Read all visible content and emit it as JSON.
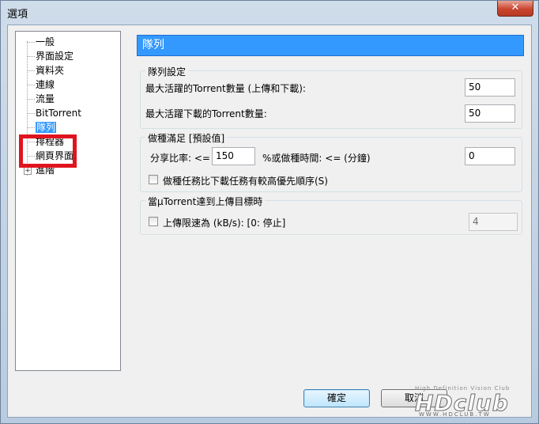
{
  "window": {
    "title": "選項",
    "close_label": "✕"
  },
  "tree": {
    "items": [
      {
        "label": "一般"
      },
      {
        "label": "界面設定"
      },
      {
        "label": "資料夾"
      },
      {
        "label": "連線"
      },
      {
        "label": "流量"
      },
      {
        "label": "BitTorrent"
      },
      {
        "label": "隊列",
        "selected": true
      },
      {
        "label": "排程器"
      },
      {
        "label": "網頁界面"
      },
      {
        "label": "進階",
        "expandable": true
      }
    ],
    "expand_symbol": "+"
  },
  "panel": {
    "header": "隊列",
    "queue_settings": {
      "title": "隊列設定",
      "max_active_label": "最大活躍的Torrent數量 (上傳和下載):",
      "max_active_value": "50",
      "max_downloads_label": "最大活躍下載的Torrent數量:",
      "max_downloads_value": "50"
    },
    "seed_goal": {
      "title": "做種滿足 [預設值]",
      "ratio_label": "分享比率: <=",
      "ratio_value": "150",
      "time_label": "%或做種時間: <= (分鐘)",
      "time_value": "0",
      "priority_checkbox_label": "做種任務比下載任務有較高優先順序(S)"
    },
    "upload_goal": {
      "title": "當μTorrent達到上傳目標時",
      "limit_checkbox_label": "上傳限速為 (kB/s): [0: 停止]",
      "limit_value": "4"
    }
  },
  "footer": {
    "ok_label": "確定",
    "cancel_label": "取消"
  },
  "watermark": {
    "brand": "HDclub",
    "slogan": "High Definition Vision Club",
    "url": "WWW.HDCLUB.TW"
  },
  "colors": {
    "selection": "#3399ff",
    "highlight_box": "#e0141e"
  }
}
